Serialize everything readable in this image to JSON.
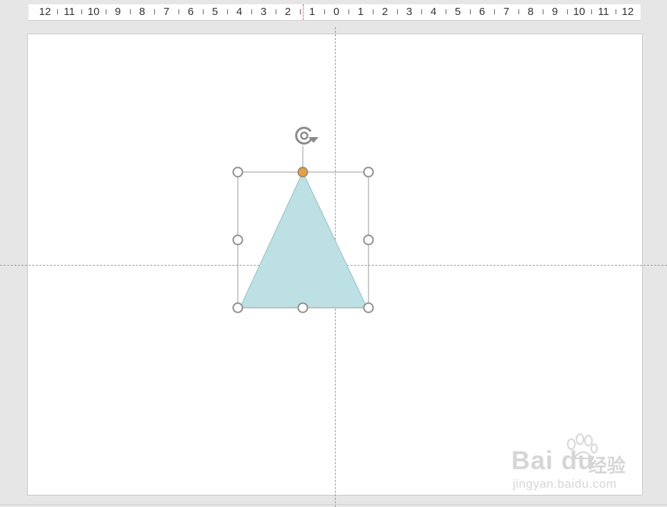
{
  "ruler": {
    "labels": [
      "12",
      "11",
      "10",
      "9",
      "8",
      "7",
      "6",
      "5",
      "4",
      "3",
      "2",
      "1",
      "0",
      "1",
      "2",
      "3",
      "4",
      "5",
      "6",
      "7",
      "8",
      "9",
      "10",
      "11",
      "12"
    ]
  },
  "slide": {
    "shape": {
      "type": "isosceles-triangle",
      "fill": "#bde0e4",
      "stroke": "#8fbfc7",
      "state": "selected"
    },
    "selection": {
      "frame_color": "#9a9a9a",
      "handle_fill": "#ffffff",
      "handle_stroke": "#8f8f8f",
      "adjust_handle_fill": "#f0a030",
      "rotate_icon": "rotate-icon"
    }
  },
  "watermark": {
    "brand": "Bai du",
    "brand_cn": "经验",
    "url": "jingyan.baidu.com"
  }
}
